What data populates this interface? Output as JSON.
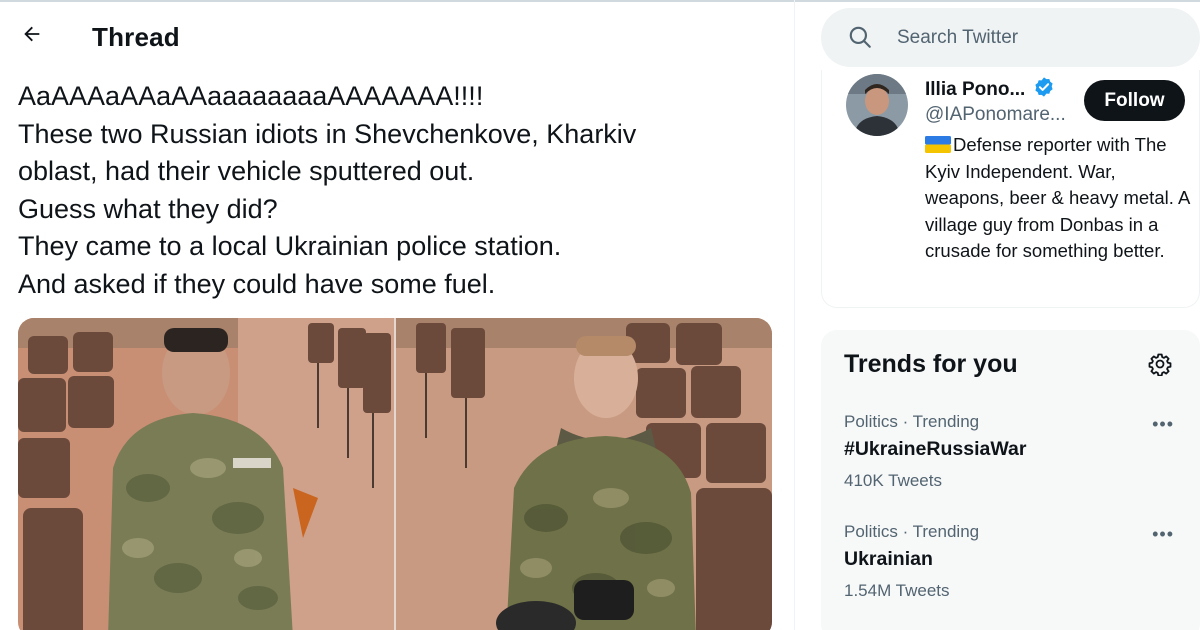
{
  "header": {
    "title": "Thread",
    "back_icon": "arrow-left-icon"
  },
  "tweet": {
    "lines": [
      "AaAAAaAAaAAaaaaaaaaAAAAAAA!!!!",
      "These two Russian idiots in Shevchenkove, Kharkiv",
      "oblast, had their vehicle sputtered out.",
      "Guess what they did?",
      "They came to a local Ukrainian police station.",
      "And asked if they could have some fuel."
    ],
    "media_count": 2
  },
  "search": {
    "placeholder": "Search Twitter",
    "icon": "search-icon"
  },
  "profile": {
    "name": "Illia Pono...",
    "handle": "@IAPonomare...",
    "follow_label": "Follow",
    "verified": true,
    "bio": "Defense reporter with The Kyiv Independent. War, weapons, beer & heavy metal. A village guy from Donbas in a crusade for something better.",
    "bio_flag": "ukraine-flag"
  },
  "trends": {
    "title": "Trends for you",
    "items": [
      {
        "meta": "Politics · Trending",
        "name": "#UkraineRussiaWar",
        "count": "410K Tweets"
      },
      {
        "meta": "Politics · Trending",
        "name": "Ukrainian",
        "count": "1.54M Tweets"
      }
    ]
  },
  "colors": {
    "accent": "#1d9bf0",
    "text": "#0f1419",
    "secondary_text": "#536471",
    "search_bg": "#eff3f4",
    "trends_bg": "#f7f9f9"
  }
}
